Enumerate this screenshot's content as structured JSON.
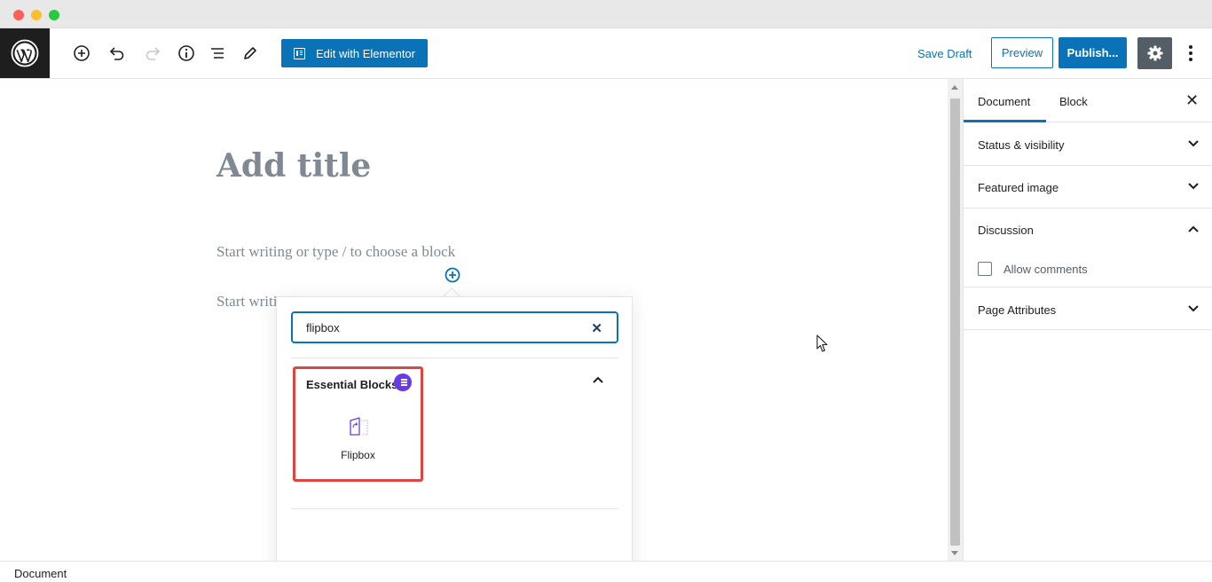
{
  "toolbar": {
    "elementor_label": "Edit with Elementor",
    "save_draft_label": "Save Draft",
    "preview_label": "Preview",
    "publish_label": "Publish..."
  },
  "editor": {
    "title_placeholder": "Add title",
    "paragraph_placeholder": "Start writing or type / to choose a block",
    "second_paragraph_visible": "Start writi"
  },
  "inserter": {
    "search_value": "flipbox",
    "category": "Essential Blocks",
    "blocks": [
      {
        "label": "Flipbox",
        "icon": "flipbox-icon"
      }
    ]
  },
  "sidebar": {
    "tabs": [
      "Document",
      "Block"
    ],
    "panels": [
      {
        "title": "Status & visibility",
        "expanded": false
      },
      {
        "title": "Featured image",
        "expanded": false
      },
      {
        "title": "Discussion",
        "expanded": true,
        "checkbox_label": "Allow comments"
      },
      {
        "title": "Page Attributes",
        "expanded": false
      }
    ]
  },
  "footer": {
    "breadcrumb": "Document"
  },
  "colors": {
    "accent": "#0a73b7",
    "highlight": "#e0443e",
    "badge": "#6a3be4"
  }
}
